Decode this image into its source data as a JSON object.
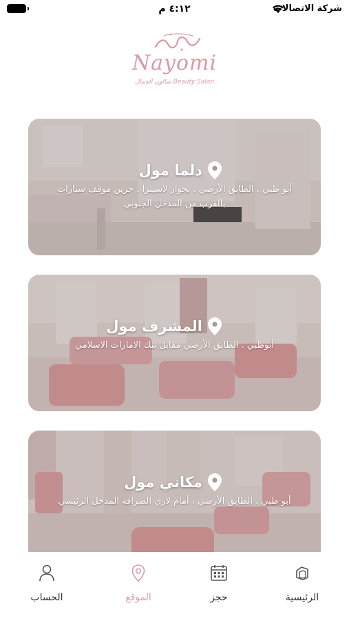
{
  "status_bar": {
    "carrier": "شركة الاتصالات",
    "time": "٤:١٢ م"
  },
  "logo": {
    "latin": "Nayomi",
    "tagline": "Beauty Salon  صالون الجمال"
  },
  "locations": [
    {
      "name": "دلما مول",
      "address": "أبو ظبي . الطابق الأرضي . بجوار لاسينزا . جرين موقف سيارات بالقرب من المدخل الجنوبي",
      "icon": "map-pin-icon"
    },
    {
      "name": "المشرف مول",
      "address": "أبوظبي . الطابق الأرضي مقابل بنك الامارات الاسلامي",
      "icon": "map-pin-icon"
    },
    {
      "name": "مكاني مول",
      "address": "أبو ظبي . الطابق الأرضي . أمام لاري الصرافة المدخل الرئيسي",
      "icon": "map-pin-icon"
    }
  ],
  "bottom_nav": {
    "items": [
      {
        "label": "الرئيسية",
        "icon": "home-icon",
        "active": false
      },
      {
        "label": "حجز",
        "icon": "calendar-icon",
        "active": false
      },
      {
        "label": "الموقع",
        "icon": "location-icon",
        "active": true
      },
      {
        "label": "الحساب",
        "icon": "user-icon",
        "active": false
      }
    ]
  },
  "colors": {
    "brand_pink": "#d99aa5",
    "text_dark": "#333333"
  }
}
